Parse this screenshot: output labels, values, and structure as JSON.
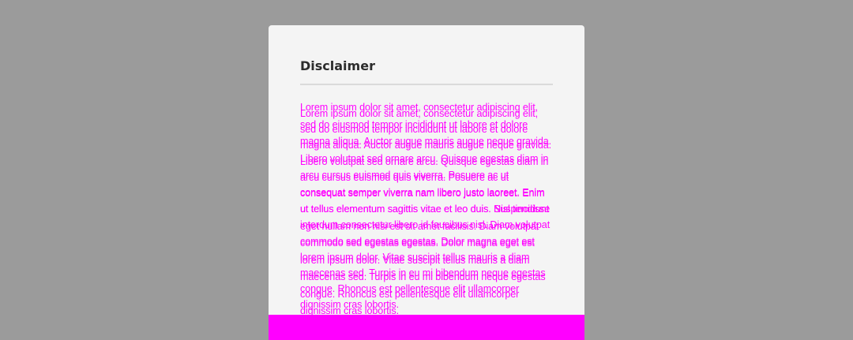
{
  "dialog": {
    "title": "Disclaimer",
    "body": "Lorem ipsum dolor sit amet, consectetur adipiscing elit, sed do eiusmod tempor incididunt ut labore et dolore magna aliqua. Auctor augue mauris augue neque gravida. Libero volutpat sed ornare arcu. Quisque egestas diam in arcu cursus euismod quis viverra. Posuere ac ut consequat semper viverra nam libero justo laoreet. Enim ut tellus elementum sagittis vitae et leo duis. Nisl tincidunt eget nullam non nisi est sit amet facilisis. Diam volutpat commodo sed egestas egestas. Dolor magna eget est lorem ipsum dolor. Vitae suscipit tellus mauris a diam maecenas sed. Turpis in eu mi bibendum neque egestas congue. Rhoncus est pellentesque elit ullamcorper dignissim cras lobortis.",
    "body_overlap": "Lorem ipsum dolor sit amet, consectetur adipiscing elit, sed do eiusmod tempor incididunt ut labore et dolore magna aliqua. Auctor augue mauris augue neque gravida. Libero volutpat sed ornare arcu. Quisque egestas diam in arcu cursus euismod quis viverra. Posuere ac ut consequat semper viverra nam libero justo laoreet. Enim ut tellus elementum sagittis vitae et leo duis. Suspendisse interdum consectetur libero id faucibus nisl. Diam volutpat commodo sed egestas egestas. Dolor magna eget est lorem ipsum dolor. Vitae suscipit tellus mauris a diam maecenas sed. Turpis in eu mi bibendum neque egestas congue. Rhoncus est pellentesque elit ullamcorper dignissim cras lobortis."
  },
  "colors": {
    "backdrop": "#9b9b9b",
    "dialog_background": "#f4f4f4",
    "body_text": "#ff00ff",
    "footer_bar": "#ff00ff"
  }
}
